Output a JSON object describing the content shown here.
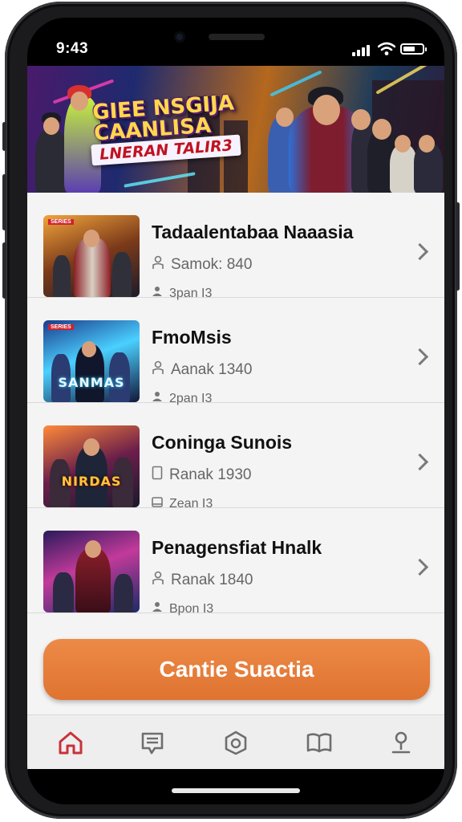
{
  "status_bar": {
    "time": "9:43"
  },
  "banner": {
    "title_line1": "GIEE NSGIJA",
    "title_line2": "CAANLISA",
    "subtitle": "LNERAN TALIR3"
  },
  "items": [
    {
      "name": "Tadaalentabaa Naaasia",
      "line1": "Samok: 840",
      "line2": "3pan I3",
      "thumb_text": ""
    },
    {
      "name": "FmoMsis",
      "line1": "Aanak 1340",
      "line2": "2pan I3",
      "thumb_text": "SANMAS"
    },
    {
      "name": "Coninga Sunois",
      "line1": "Ranak 1930",
      "line2": "Zean I3",
      "thumb_text": "NIRDAS"
    },
    {
      "name": "Penagensfiat Hnalk",
      "line1": "Ranak 1840",
      "line2": "Bpon I3",
      "thumb_text": ""
    }
  ],
  "cta": {
    "label": "Cantie Suactia"
  },
  "tabs": [
    {
      "name": "home",
      "color": "#c9323b"
    },
    {
      "name": "chat",
      "color": "#6e6e6e"
    },
    {
      "name": "explore",
      "color": "#6e6e6e"
    },
    {
      "name": "book",
      "color": "#6e6e6e"
    },
    {
      "name": "profile",
      "color": "#6e6e6e"
    }
  ],
  "colors": {
    "accent": "#e07a3a",
    "active_tab": "#c9323b"
  }
}
